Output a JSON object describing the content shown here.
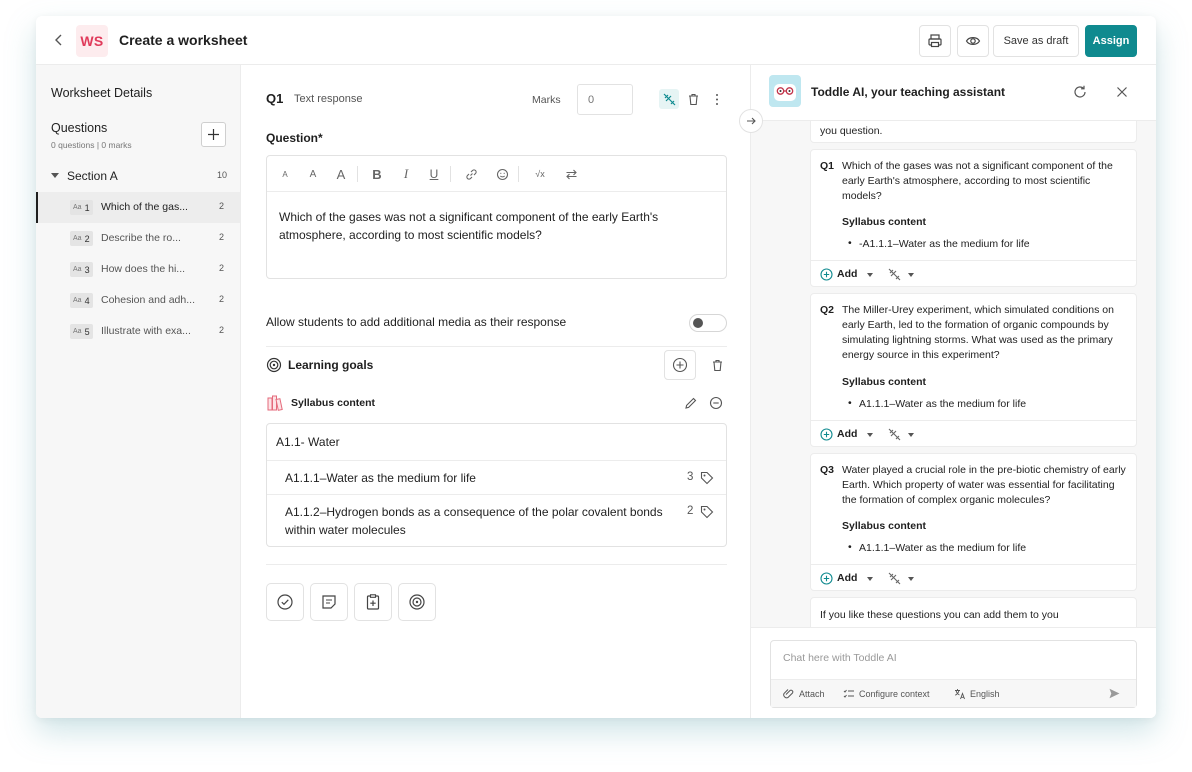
{
  "header": {
    "badge": "WS",
    "title": "Create a worksheet",
    "save_draft_label": "Save as draft",
    "assign_label": "Assign",
    "assign_color": "#0f8a8f"
  },
  "sidebar": {
    "details_label": "Worksheet Details",
    "questions_label": "Questions",
    "questions_sub": "0 questions | 0 marks",
    "section": {
      "name": "Section A",
      "count": "10"
    },
    "items": [
      {
        "type": "Aa",
        "num": "1",
        "text": "Which of the gas...",
        "marks": "2"
      },
      {
        "type": "Aa",
        "num": "2",
        "text": "Describe the ro...",
        "marks": "2"
      },
      {
        "type": "Aa",
        "num": "3",
        "text": "How does the hi...",
        "marks": "2"
      },
      {
        "type": "Aa",
        "num": "4",
        "text": "Cohesion and adh...",
        "marks": "2"
      },
      {
        "type": "Aa",
        "num": "5",
        "text": "Illustrate with exa...",
        "marks": "2"
      }
    ]
  },
  "editor": {
    "q_label": "Q1",
    "q_type": "Text response",
    "marks_label": "Marks",
    "marks_placeholder": "0",
    "question_label": "Question*",
    "question_text": "Which of the gases was not a significant component of the early Earth's atmosphere, according to most scientific models?",
    "allow_media_label": "Allow students to add additional media as their response",
    "allow_media_on": false,
    "learning_goals_label": "Learning goals",
    "syllabus_label": "Syllabus content",
    "syllabus": {
      "heading": "A1.1- Water",
      "items": [
        {
          "text": "A1.1.1–Water as the medium for life",
          "count": "3"
        },
        {
          "text": "A1.1.2–Hydrogen bonds as a consequence of the polar covalent bonds within water  molecules",
          "count": "2"
        }
      ]
    }
  },
  "ai_panel": {
    "title": "Toddle AI, your teaching assistant",
    "intro_tail": "you question.",
    "cards": [
      {
        "num": "Q1",
        "text": "Which of the gases was not a significant component of the early Earth's atmosphere, according to most scientific models?",
        "syllabus_label": "Syllabus content",
        "syllabus_item": "-A1.1.1–Water as the medium for life",
        "add_label": "Add"
      },
      {
        "num": "Q2",
        "text": "The Miller-Urey experiment, which simulated conditions on early Earth, led to the formation of organic compounds by simulating lightning storms. What was used as the primary energy source in this experiment?",
        "syllabus_label": "Syllabus content",
        "syllabus_item": "A1.1.1–Water as the medium for life",
        "add_label": "Add"
      },
      {
        "num": "Q3",
        "text": "Water played a crucial role in the pre-biotic chemistry of early Earth. Which property of water was essential for facilitating the formation of complex organic molecules?",
        "syllabus_label": "Syllabus content",
        "syllabus_item": "A1.1.1–Water as the medium for life",
        "add_label": "Add"
      }
    ],
    "outro": "If you like these questions you can add them to you",
    "chat_placeholder": "Chat here with Toddle AI",
    "attach_label": "Attach",
    "configure_label": "Configure context",
    "language_label": "English"
  }
}
